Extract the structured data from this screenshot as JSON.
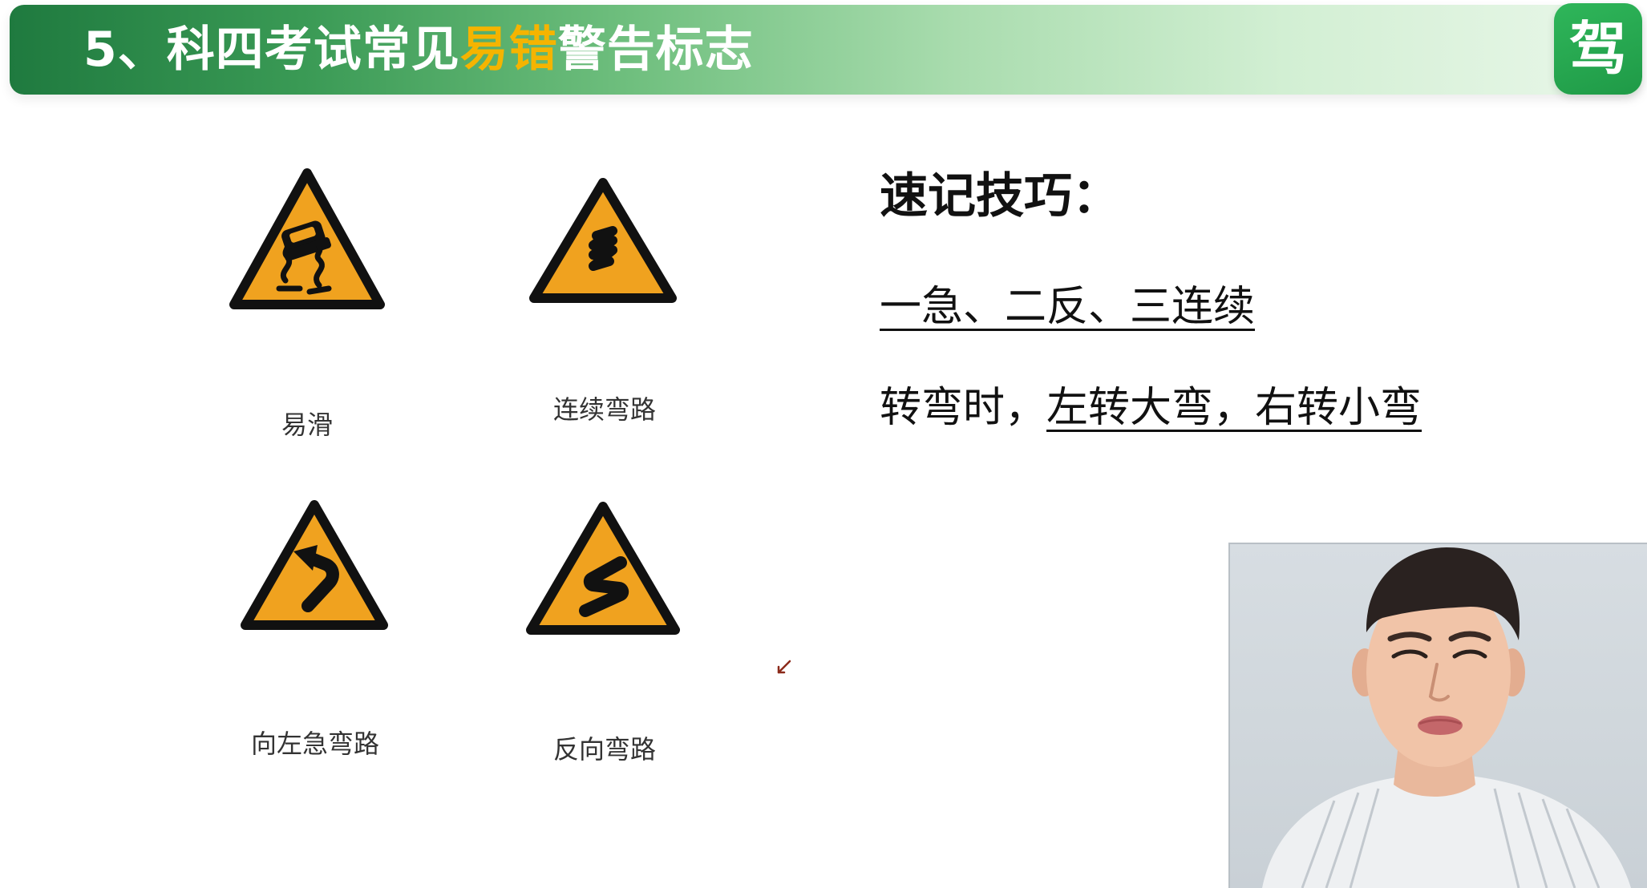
{
  "header": {
    "title_prefix": "5、科四考试常见",
    "title_highlight": "易错",
    "title_suffix": "警告标志",
    "logo_text": "驾"
  },
  "signs": [
    {
      "label": "易滑",
      "icon": "slippery-road-icon"
    },
    {
      "label": "连续弯路",
      "icon": "continuous-curves-icon"
    },
    {
      "label": "向左急弯路",
      "icon": "sharp-left-curve-icon"
    },
    {
      "label": "反向弯路",
      "icon": "reverse-curve-icon"
    }
  ],
  "tips": {
    "heading": "速记技巧：",
    "mnemonic": "一急、二反、三连续",
    "turn_prefix": "转弯时，",
    "turn_rule": "左转大弯，右转小弯"
  },
  "colors": {
    "banner_green": "#1f7a3f",
    "highlight_yellow": "#f5b400",
    "sign_fill": "#f0a21f",
    "sign_border": "#111111",
    "logo_green": "#2fb65a"
  }
}
